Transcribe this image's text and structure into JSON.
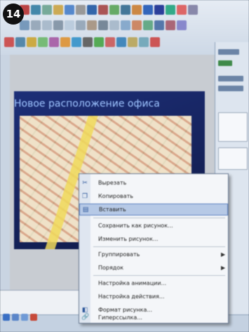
{
  "step_badge": "14",
  "slide": {
    "title": "Новое расположение офиса"
  },
  "context_menu": {
    "items": [
      {
        "label": "Вырезать",
        "icon": "scissors-icon"
      },
      {
        "label": "Копировать",
        "icon": "copy-icon"
      },
      {
        "label": "Вставить",
        "icon": "paste-icon",
        "highlighted": true
      },
      {
        "label": "Сохранить как рисунок...",
        "icon": ""
      },
      {
        "label": "Изменить рисунок...",
        "icon": ""
      },
      {
        "label": "Группировать",
        "icon": "",
        "submenu": true
      },
      {
        "label": "Порядок",
        "icon": "",
        "submenu": true
      },
      {
        "label": "Настройка анимации...",
        "icon": ""
      },
      {
        "label": "Настройка действия...",
        "icon": ""
      },
      {
        "label": "Формат рисунка...",
        "icon": "format-icon"
      },
      {
        "label": "Гиперссылка...",
        "icon": "hyperlink-icon"
      }
    ]
  },
  "colors": {
    "slide_bg": "#15225a",
    "menu_highlight": "#b6c9e6",
    "title_text": "#9ec4ff"
  }
}
